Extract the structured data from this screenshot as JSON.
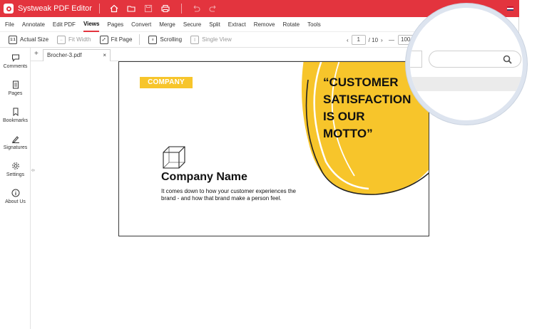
{
  "app": {
    "title": "Systweak PDF Editor",
    "accent": "#e3343e"
  },
  "titlebar_icons": [
    "home-icon",
    "folder-icon",
    "save-icon",
    "print-icon",
    "undo-icon",
    "redo-icon"
  ],
  "menu": [
    "File",
    "Annotate",
    "Edit PDF",
    "Views",
    "Pages",
    "Convert",
    "Merge",
    "Secure",
    "Split",
    "Extract",
    "Remove",
    "Rotate",
    "Tools"
  ],
  "menu_active": "Views",
  "toolbar": {
    "actual_size": "Actual Size",
    "actual_size_icon_text": "1:1",
    "fit_width": "Fit Width",
    "fit_page": "Fit Page",
    "scrolling": "Scrolling",
    "single_view": "Single View",
    "page_current": "1",
    "page_total": "/ 10",
    "zoom_value": "100 %",
    "prev": "‹",
    "next": "›",
    "zoom_out": "—"
  },
  "sidebar": {
    "items": [
      {
        "label": "Comments",
        "icon": "comments-icon"
      },
      {
        "label": "Pages",
        "icon": "pages-icon"
      },
      {
        "label": "Bookmarks",
        "icon": "bookmark-icon"
      },
      {
        "label": "Signatures",
        "icon": "signature-icon"
      },
      {
        "label": "Settings",
        "icon": "gear-icon"
      },
      {
        "label": "About Us",
        "icon": "info-icon"
      }
    ]
  },
  "tabs": {
    "add": "+",
    "active_file": "Brocher-3.pdf",
    "close": "×"
  },
  "document": {
    "badge": "COMPANY",
    "company_name": "Company Name",
    "description": "It comes down to how your customer experiences the brand - and how that brand make a person feel.",
    "motto": "“CUSTOMER\nSATISFACTION\nIS OUR\nMOTTO”",
    "brand_yellow": "#f7c52b"
  },
  "search": {
    "placeholder": "",
    "icon": "search-icon"
  }
}
